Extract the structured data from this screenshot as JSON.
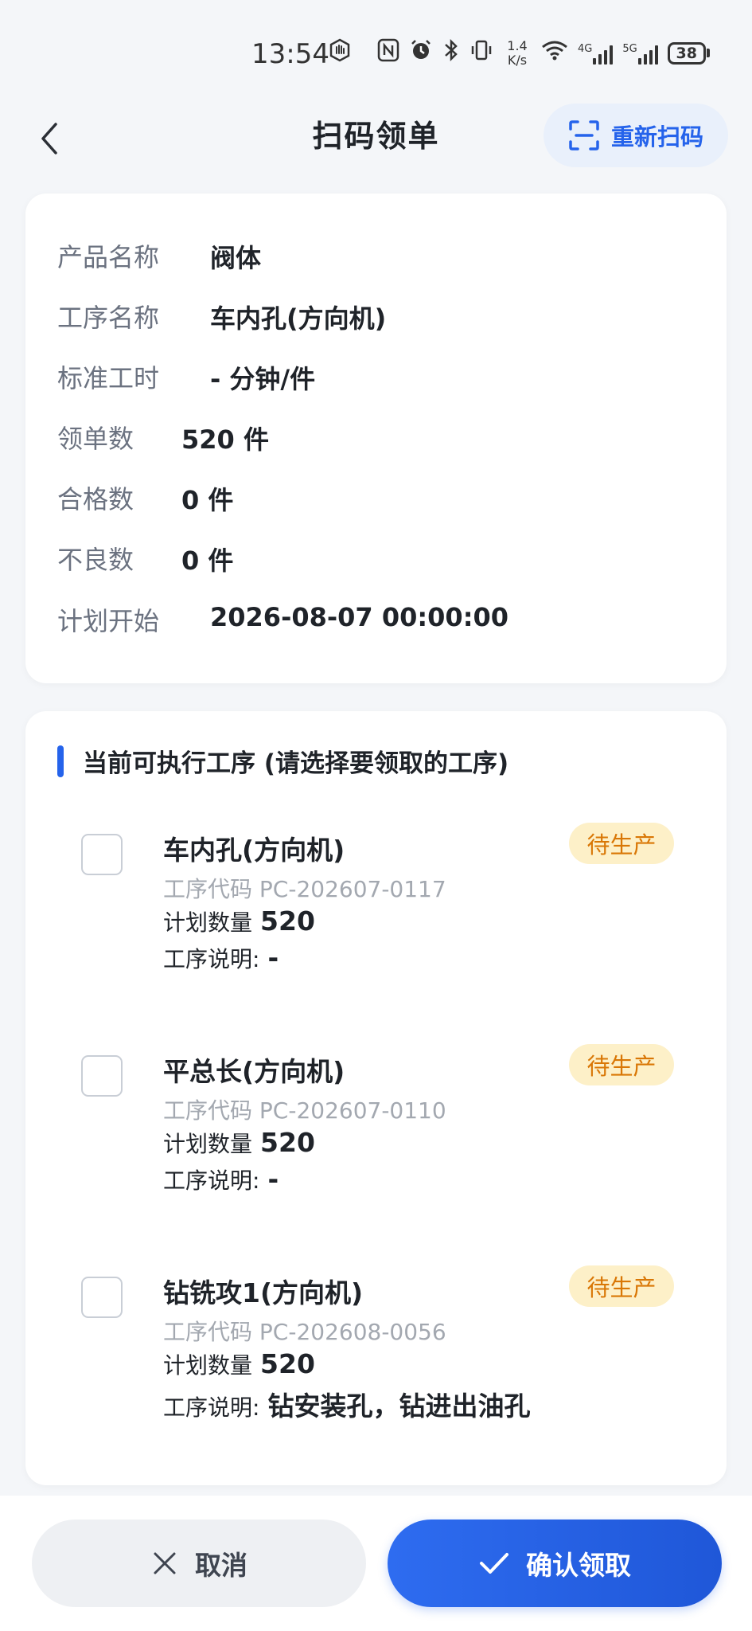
{
  "status_bar": {
    "time": "13:54",
    "net_speed_value": "1.4",
    "net_speed_unit": "K/s",
    "sig1_label": "4G",
    "sig2_label": "5G",
    "battery": "38"
  },
  "header": {
    "title": "扫码领单",
    "rescan_label": "重新扫码"
  },
  "info": {
    "product_name_label": "产品名称",
    "product_name_value": "阀体",
    "process_name_label": "工序名称",
    "process_name_value": "车内孔(方向机)",
    "std_time_label": "标准工时",
    "std_time_value": "- 分钟/件",
    "order_qty_label": "领单数",
    "order_qty_value": "520 件",
    "qualified_label": "合格数",
    "qualified_value": "0 件",
    "defective_label": "不良数",
    "defective_value": "0 件",
    "plan_start_label": "计划开始",
    "plan_start_value": "2026-08-07 00:00:00"
  },
  "process_section": {
    "title": "当前可执行工序 (请选择要领取的工序)",
    "items": [
      {
        "name": "车内孔(方向机)",
        "code": "工序代码  PC-202607-0117",
        "qty_label": "计划数量",
        "qty_value": "520",
        "desc_label": "工序说明:",
        "desc_value": "-",
        "status": "待生产"
      },
      {
        "name": "平总长(方向机)",
        "code": "工序代码  PC-202607-0110",
        "qty_label": "计划数量",
        "qty_value": "520",
        "desc_label": "工序说明:",
        "desc_value": "-",
        "status": "待生产"
      },
      {
        "name": "钻铣攻1(方向机)",
        "code": "工序代码  PC-202608-0056",
        "qty_label": "计划数量",
        "qty_value": "520",
        "desc_label": "工序说明:",
        "desc_value": "钻安装孔，钻进出油孔",
        "status": "待生产"
      }
    ]
  },
  "actions": {
    "cancel_label": "取消",
    "confirm_label": "确认领取"
  },
  "colors": {
    "accent": "#2563eb",
    "badge_bg": "#fdf0c8",
    "badge_text": "#d97706"
  }
}
